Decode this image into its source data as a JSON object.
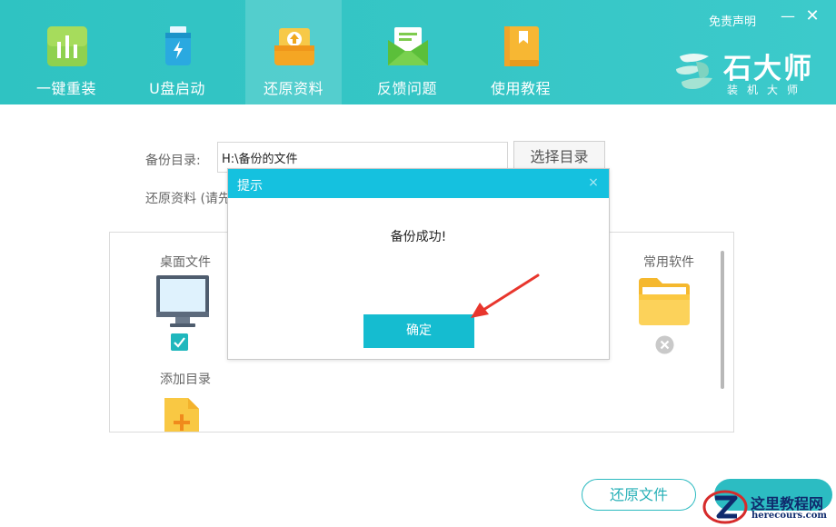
{
  "header": {
    "tabs": [
      {
        "label": "一键重装",
        "icon": "bar-chart-icon",
        "active": false
      },
      {
        "label": "U盘启动",
        "icon": "usb-drive-icon",
        "active": false
      },
      {
        "label": "还原资料",
        "icon": "restore-data-icon",
        "active": true
      },
      {
        "label": "反馈问题",
        "icon": "envelope-icon",
        "active": false
      },
      {
        "label": "使用教程",
        "icon": "book-icon",
        "active": false
      }
    ],
    "disclaimer": "免责声明",
    "minimize": "—",
    "close": "✕",
    "brand": {
      "name": "石大师",
      "subtitle": "装机大师"
    }
  },
  "main": {
    "backup_dir_label": "备份目录:",
    "backup_dir_value": "H:\\备份的文件",
    "select_dir_button": "选择目录",
    "restore_hint": "还原资料 (请先",
    "items": {
      "desktop_files": "桌面文件",
      "add_directory": "添加目录",
      "common_software": "常用软件"
    },
    "desktop_checked": true,
    "restore_file_button": "还原文件"
  },
  "dialog": {
    "title": "提示",
    "close": "×",
    "message": "备份成功!",
    "confirm": "确定"
  },
  "watermark": {
    "title": "这里教程网",
    "url": "herecours.com"
  },
  "colors": {
    "header_bg": "#36c6c6",
    "dialog_header": "#15c1df",
    "confirm_button": "#15bcd0",
    "accent": "#2cbcc2",
    "arrow": "#e8362d"
  }
}
